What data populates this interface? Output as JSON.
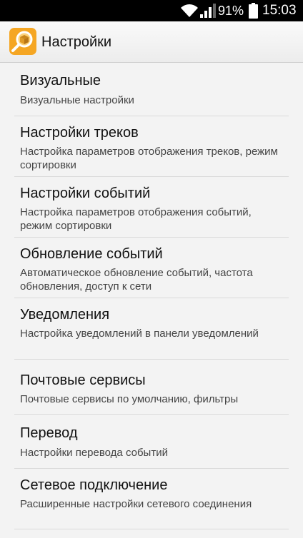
{
  "status_bar": {
    "battery_percent": "91%",
    "time": "15:03",
    "icons": [
      "wifi-icon",
      "signal-icon",
      "battery-icon"
    ]
  },
  "action_bar": {
    "title": "Настройки",
    "icon": "app-logo-icon"
  },
  "items": [
    {
      "title": "Визуальные",
      "summary": "Визуальные настройки"
    },
    {
      "title": "Настройки треков",
      "summary": "Настройка параметров отображения треков, режим сортировки"
    },
    {
      "title": "Настройки событий",
      "summary": "Настройка параметров отображения событий, режим сортировки"
    },
    {
      "title": "Обновление событий",
      "summary": "Автоматическое обновление событий, частота обновления, доступ к сети"
    },
    {
      "title": "Уведомления",
      "summary": "Настройка уведомлений в панели уведомлений"
    },
    {
      "title": "Почтовые сервисы",
      "summary": "Почтовые сервисы по умолчанию, фильтры"
    },
    {
      "title": "Перевод",
      "summary": "Настройки перевода событий"
    },
    {
      "title": "Сетевое подключение",
      "summary": "Расширенные настройки сетевого соединения"
    }
  ],
  "colors": {
    "status_bar": "#000000",
    "background": "#f3f3f3",
    "icon_orange": "#f5a623"
  }
}
